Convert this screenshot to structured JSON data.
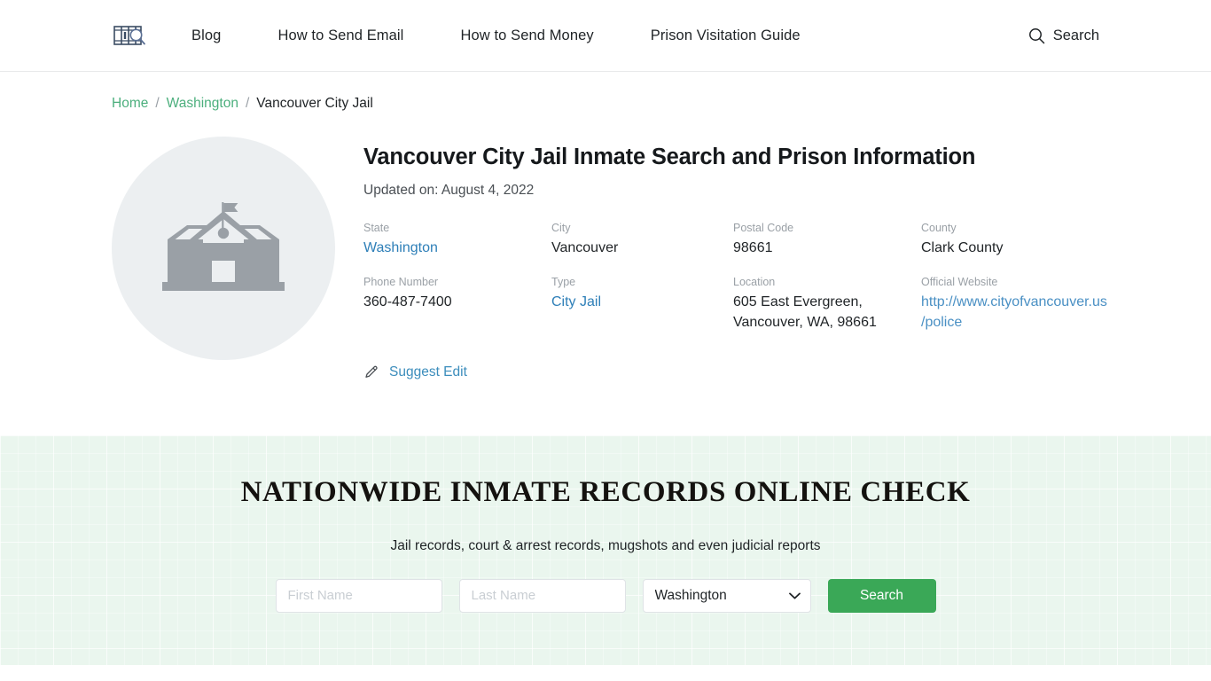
{
  "header": {
    "logo_name": "prison-bars-search-logo",
    "nav": [
      {
        "label": "Blog"
      },
      {
        "label": "How to Send Email"
      },
      {
        "label": "How to Send Money"
      },
      {
        "label": "Prison Visitation Guide"
      }
    ],
    "search_label": "Search",
    "search_icon": "search-icon"
  },
  "breadcrumb": {
    "home": "Home",
    "state": "Washington",
    "current": "Vancouver City Jail",
    "separator": "/"
  },
  "profile": {
    "avatar_icon": "government-building-icon",
    "title": "Vancouver City Jail Inmate Search and Prison Information",
    "updated": "Updated on: August 4, 2022",
    "fields": [
      {
        "label": "State",
        "value": "Washington",
        "link": true
      },
      {
        "label": "City",
        "value": "Vancouver",
        "link": false
      },
      {
        "label": "Postal Code",
        "value": "98661",
        "link": false
      },
      {
        "label": "County",
        "value": "Clark County",
        "link": false
      },
      {
        "label": "Phone Number",
        "value": "360-487-7400",
        "link": false
      },
      {
        "label": "Type",
        "value": "City Jail",
        "link": true
      },
      {
        "label": "Location",
        "value": "605 East Evergreen, Vancouver, WA, 98661",
        "link": false
      },
      {
        "label": "Official Website",
        "value": "http://www.cityofvancouver.us/police",
        "link": true
      }
    ],
    "suggest_edit": "Suggest Edit",
    "suggest_edit_icon": "pencil-icon"
  },
  "search_section": {
    "heading": "NATIONWIDE INMATE RECORDS ONLINE CHECK",
    "subheading": "Jail records, court & arrest records, mugshots and even judicial reports",
    "first_name_placeholder": "First Name",
    "first_name_value": "",
    "last_name_placeholder": "Last Name",
    "last_name_value": "",
    "state_selected": "Washington",
    "state_options": [
      "Washington"
    ],
    "button_label": "Search",
    "caret_icon": "chevron-down-icon"
  },
  "colors": {
    "accent_green": "#3aa857",
    "breadcrumb_link": "#4caf7d",
    "link_blue": "#3c8dbc",
    "section_bg": "#eaf6ee",
    "avatar_bg": "#eceff1"
  }
}
